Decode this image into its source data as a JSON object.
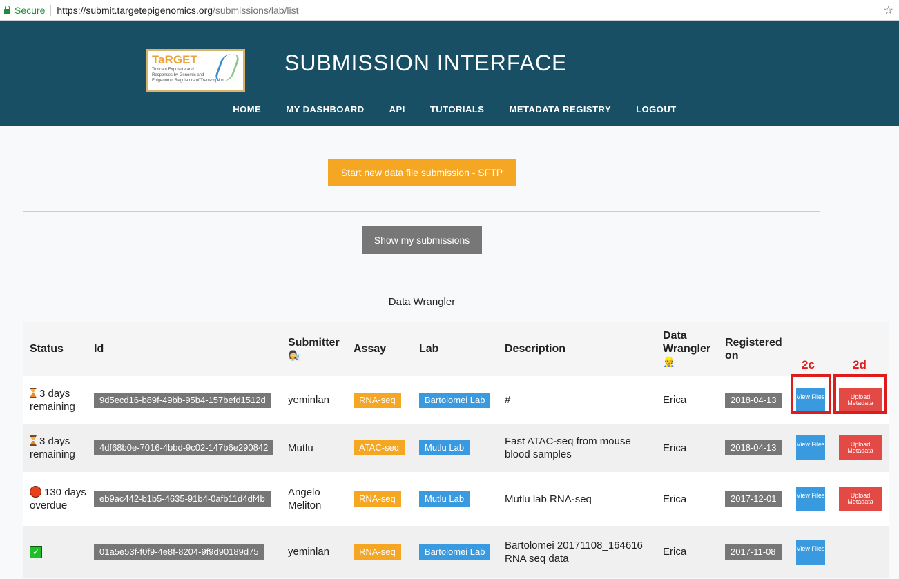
{
  "browser": {
    "secure": "Secure",
    "url_host": "https://submit.targetepigenomics.org",
    "url_path": "/submissions/lab/list"
  },
  "header": {
    "logo_title": "TaRGET",
    "logo_subtitle": [
      "Toxicant Exposure and",
      "Responses by Genomic and",
      "Epigenomic Regulators of Transcription"
    ],
    "title": "SUBMISSION INTERFACE",
    "nav": [
      "HOME",
      "MY DASHBOARD",
      "API",
      "TUTORIALS",
      "METADATA REGISTRY",
      "LOGOUT"
    ]
  },
  "actions": {
    "start_submission": "Start new data file submission - SFTP",
    "show_submissions": "Show my submissions"
  },
  "section_title": "Data Wrangler",
  "table": {
    "headers": {
      "status": "Status",
      "id": "Id",
      "submitter": "Submitter",
      "assay": "Assay",
      "lab": "Lab",
      "description": "Description",
      "wrangler": "Data Wrangler",
      "registered": "Registered on"
    },
    "view_label": "View Files",
    "upload_label": "Upload Metadata",
    "rows": [
      {
        "status_icon": "hourglass",
        "status": "3 days remaining",
        "id": "9d5ecd16-b89f-49bb-95b4-157befd1512d",
        "submitter": "yeminlan",
        "assay": "RNA-seq",
        "lab": "Bartolomei Lab",
        "description": "#",
        "wrangler": "Erica",
        "registered": "2018-04-13"
      },
      {
        "status_icon": "hourglass",
        "status": "3 days remaining",
        "id": "4df68b0e-7016-4bbd-9c02-147b6e290842",
        "submitter": "Mutlu",
        "assay": "ATAC-seq",
        "lab": "Mutlu Lab",
        "description": "Fast ATAC-seq from mouse blood samples",
        "wrangler": "Erica",
        "registered": "2018-04-13"
      },
      {
        "status_icon": "red-circle",
        "status": "130 days overdue",
        "id": "eb9ac442-b1b5-4635-91b4-0afb11d4df4b",
        "submitter": "Angelo Meliton",
        "assay": "RNA-seq",
        "lab": "Mutlu Lab",
        "description": "Mutlu lab RNA-seq",
        "wrangler": "Erica",
        "registered": "2017-12-01"
      },
      {
        "status_icon": "check",
        "status": "",
        "id": "01a5e53f-f0f9-4e8f-8204-9f9d90189d75",
        "submitter": "yeminlan",
        "assay": "RNA-seq",
        "lab": "Bartolomei Lab",
        "description": "Bartolomei 20171108_164616 RNA seq data",
        "wrangler": "Erica",
        "registered": "2017-11-08"
      }
    ]
  },
  "annotations": [
    "2c",
    "2d"
  ]
}
